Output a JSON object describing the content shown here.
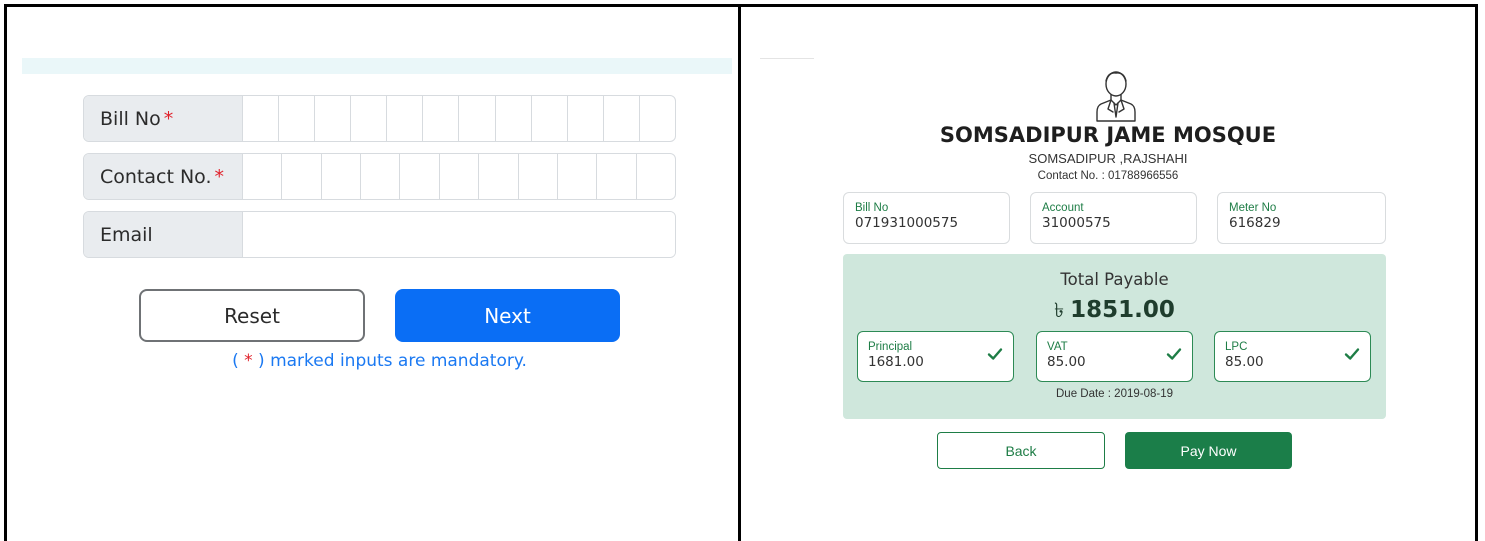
{
  "bill_form": {
    "fields": [
      {
        "label": "Bill No",
        "required_mark": "*",
        "type": "digit-boxes",
        "value": ""
      },
      {
        "label": "Contact No.",
        "required_mark": "*",
        "type": "digit-boxes",
        "value": ""
      },
      {
        "label": "Email",
        "required_mark": "",
        "type": "text",
        "value": ""
      }
    ],
    "reset_label": "Reset",
    "next_label": "Next",
    "note": {
      "prefix": "( ",
      "star": "*",
      "suffix": " ) marked inputs are mandatory."
    },
    "colors": {
      "primary": "#0a6ef5",
      "required": "#e0212b",
      "note": "#1b79f2"
    }
  },
  "payment": {
    "avatar_icon": "businessman-icon",
    "org_name": "SOMSADIPUR JAME MOSQUE",
    "org_address": "SOMSADIPUR ,RAJSHAHI",
    "contact": "Contact No. : 01788966556",
    "info": [
      {
        "label": "Bill No",
        "value": "071931000575"
      },
      {
        "label": "Account",
        "value": "31000575"
      },
      {
        "label": "Meter No",
        "value": "616829"
      }
    ],
    "total_label": "Total Payable",
    "currency_symbol": "৳",
    "total_amount": "1851.00",
    "components": [
      {
        "label": "Principal",
        "value": "1681.00",
        "status_icon": "check-icon"
      },
      {
        "label": "VAT",
        "value": "85.00",
        "status_icon": "check-icon"
      },
      {
        "label": "LPC",
        "value": "85.00",
        "status_icon": "check-icon"
      }
    ],
    "due_date": "Due Date : 2019-08-19",
    "back_label": "Back",
    "pay_label": "Pay Now",
    "colors": {
      "accent": "#1b7e49",
      "panel": "#cfe7dc"
    }
  }
}
